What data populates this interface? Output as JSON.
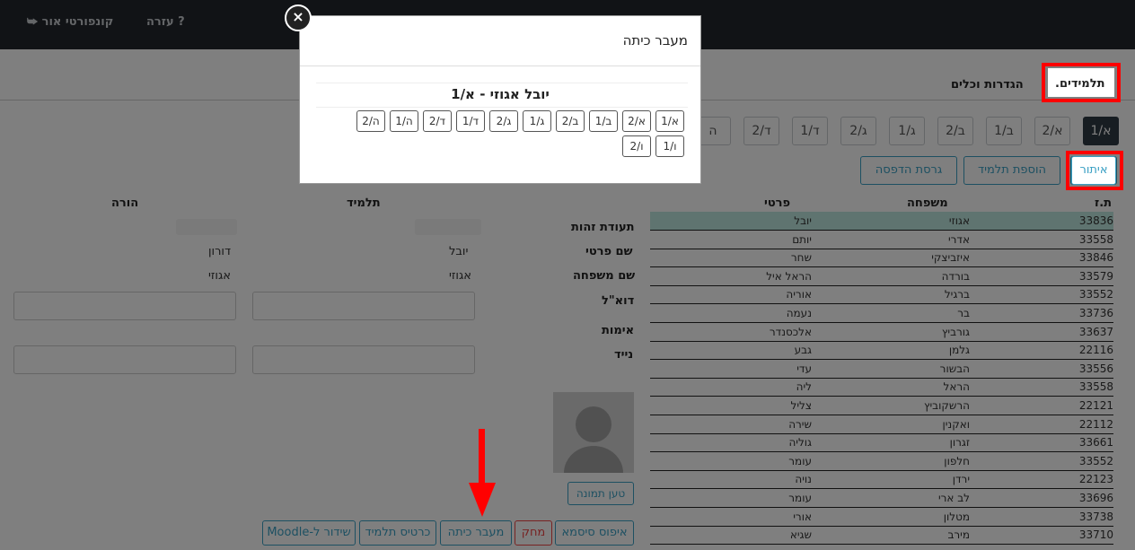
{
  "topnav": {
    "logout": "קונפורטי אור",
    "help": "עזרה"
  },
  "tabs": {
    "students": ".תלמידים",
    "settings": "הגדרות וכלים"
  },
  "classes": [
    "א/1",
    "א/2",
    "ב/1",
    "ב/2",
    "ג/1",
    "ג/2",
    "ד/1",
    "ד/2",
    "ה"
  ],
  "actions": {
    "search": "איתור",
    "add": "הוספת תלמיד",
    "print": "גרסת הדפסה"
  },
  "table": {
    "headers": {
      "id": "ת.ז",
      "family": "משפחה",
      "first": "פרטי"
    },
    "rows": [
      {
        "id": "33836",
        "family": "אגוזי",
        "first": "יובל"
      },
      {
        "id": "33558",
        "family": "אדרי",
        "first": "יותם"
      },
      {
        "id": "33846",
        "family": "איזביצקי",
        "first": "שחר"
      },
      {
        "id": "33579",
        "family": "בורדה",
        "first": "הראל איל"
      },
      {
        "id": "33552",
        "family": "ברגיל",
        "first": "אוריה"
      },
      {
        "id": "33736",
        "family": "בר",
        "first": "נעמה"
      },
      {
        "id": "33637",
        "family": "גורביץ",
        "first": "אלכסנדר"
      },
      {
        "id": "22116",
        "family": "גלמן",
        "first": "גבע"
      },
      {
        "id": "33556",
        "family": "הבשור",
        "first": "עדי"
      },
      {
        "id": "33558",
        "family": "הראל",
        "first": "ליה"
      },
      {
        "id": "22121",
        "family": "הרשקוביץ",
        "first": "צליל"
      },
      {
        "id": "22112",
        "family": "ואקנין",
        "first": "שירה"
      },
      {
        "id": "33661",
        "family": "זגרון",
        "first": "גוליה"
      },
      {
        "id": "33552",
        "family": "חלפון",
        "first": "עומר"
      },
      {
        "id": "22123",
        "family": "ירדן",
        "first": "נויה"
      },
      {
        "id": "33696",
        "family": "לב ארי",
        "first": "עומר"
      },
      {
        "id": "33738",
        "family": "מטלון",
        "first": "אורי"
      },
      {
        "id": "33710",
        "family": "מירב",
        "first": "שגיא"
      }
    ]
  },
  "details": {
    "col_student": "תלמיד",
    "col_parent": "הורה",
    "labels": {
      "id": "תעודת זהות",
      "first": "שם פרטי",
      "family": "שם משפחה",
      "email": "דוא\"ל",
      "verify": "אימות",
      "mobile": "נייד"
    },
    "student": {
      "first": "יובל",
      "family": "אגוזי"
    },
    "parent": {
      "first": "דורון",
      "family": "אגוזי"
    }
  },
  "photo_button": "טען תמונה",
  "bottom_actions": {
    "reset": "איפוס סיסמא",
    "delete": "מחק",
    "transfer": "מעבר כיתה",
    "card": "כרטיס תלמיד",
    "moodle": "שידור ל-Moodle"
  },
  "modal": {
    "title": "מעבר כיתה",
    "student": "יובל אגוזי - א/1",
    "close": "×",
    "classes_row1": [
      "א/1",
      "א/2",
      "ב/1",
      "ב/2",
      "ג/1",
      "ג/2",
      "ד/1",
      "ד/2",
      "ה/1",
      "ה/2"
    ],
    "classes_row2": [
      "ו/1",
      "ו/2"
    ]
  },
  "colors": {
    "highlight": "#ff0000",
    "accent": "#3aa0c4",
    "active": "#2f3b45"
  }
}
